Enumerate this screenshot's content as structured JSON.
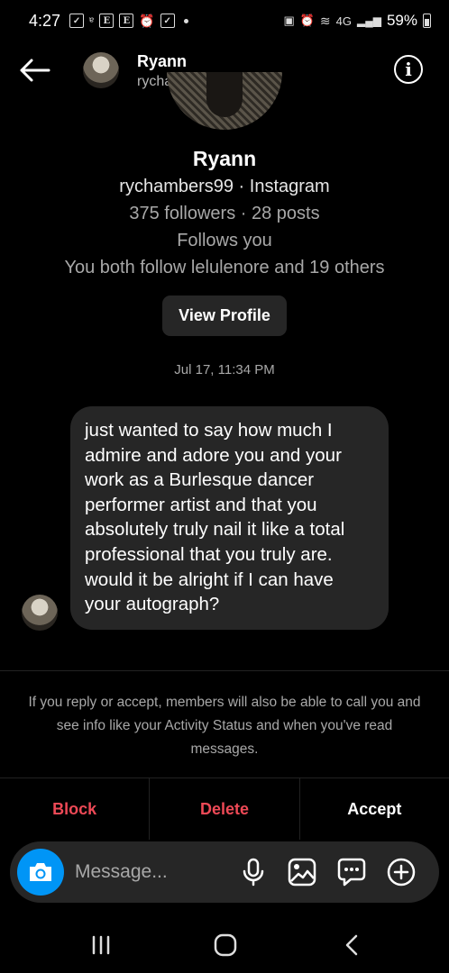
{
  "status_bar": {
    "time": "4:27",
    "network": "4G",
    "battery": "59%"
  },
  "header": {
    "name": "Ryann",
    "username": "rychambers99",
    "info_icon": "info-icon"
  },
  "profile": {
    "name": "Ryann",
    "handle_line": "rychambers99 · Instagram",
    "stats_line": "375 followers · 28 posts",
    "follows_line": "Follows you",
    "mutual_line": "You both follow lelulenore and 19 others",
    "view_profile_label": "View Profile"
  },
  "conversation": {
    "timestamp": "Jul 17, 11:34 PM",
    "message": "just wanted to say how much I admire and adore you and your work as a Burlesque dancer performer artist and that you absolutely truly nail it like a total professional that you truly are. would it be alright if I can have your autograph?"
  },
  "request_notice": "If you reply or accept, members will also be able to call you and see info like your Activity Status and when you've read messages.",
  "actions": {
    "block": "Block",
    "delete": "Delete",
    "accept": "Accept"
  },
  "composer": {
    "placeholder": "Message..."
  },
  "colors": {
    "background": "#000000",
    "bubble": "#262626",
    "danger": "#ed4956",
    "camera": "#0095f6"
  }
}
